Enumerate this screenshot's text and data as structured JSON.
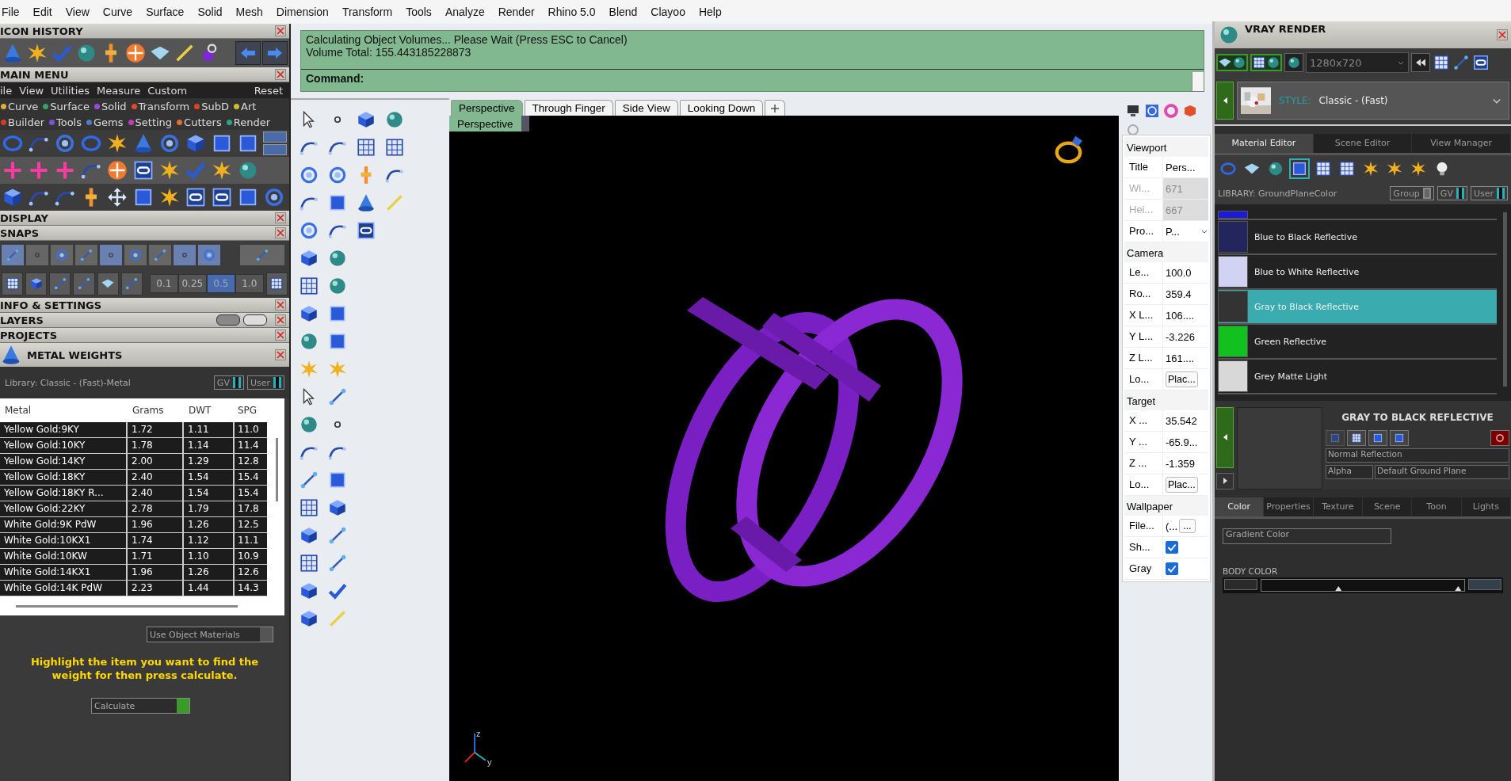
{
  "menu_bar": [
    "File",
    "Edit",
    "View",
    "Curve",
    "Surface",
    "Solid",
    "Mesh",
    "Dimension",
    "Transform",
    "Tools",
    "Analyze",
    "Render",
    "Rhino 5.0",
    "Blend",
    "Clayoo",
    "Help"
  ],
  "icon_history": {
    "title": "ICON HISTORY"
  },
  "main_menu": {
    "title": "MAIN MENU",
    "menu": [
      "ile",
      "View",
      "Utilities",
      "Measure",
      "Custom"
    ],
    "reset": "Reset",
    "category_rows": [
      {
        "items": [
          {
            "label": "Curve",
            "color": "#d8b03a"
          },
          {
            "label": "Surface",
            "color": "#3c9e6a"
          },
          {
            "label": "Solid",
            "color": "#9a4ad8"
          },
          {
            "label": "Transform",
            "color": "#e0482a"
          },
          {
            "label": "SubD",
            "color": "#e0402a"
          },
          {
            "label": "Art",
            "color": "#c8c032"
          }
        ]
      },
      {
        "items": [
          {
            "label": "Builder",
            "color": "#d83a2a"
          },
          {
            "label": "Tools",
            "color": "#7a52d8"
          },
          {
            "label": "Gems",
            "color": "#4a7ec0"
          },
          {
            "label": "Setting",
            "color": "#c83ab0"
          },
          {
            "label": "Cutters",
            "color": "#e0702a"
          },
          {
            "label": "Render",
            "color": "#2ea08e"
          }
        ]
      }
    ]
  },
  "display": {
    "title": "DISPLAY"
  },
  "snaps": {
    "title": "SNAPS",
    "toggles": [
      {
        "on": true
      },
      {
        "on": false
      },
      {
        "on": false
      },
      {
        "on": false
      },
      {
        "on": true
      },
      {
        "on": false
      },
      {
        "on": false
      },
      {
        "on": true
      },
      {
        "on": true
      },
      {
        "on": false
      }
    ],
    "steps": [
      {
        "label": "0.1",
        "selected": false
      },
      {
        "label": "0.25",
        "selected": false
      },
      {
        "label": "0.5",
        "selected": true
      },
      {
        "label": "1.0",
        "selected": false
      }
    ]
  },
  "info_settings": {
    "title": "INFO & SETTINGS"
  },
  "layers": {
    "title": "LAYERS"
  },
  "projects": {
    "title": "PROJECTS"
  },
  "metal_weights": {
    "title": "METAL WEIGHTS",
    "library": "Library: Classic - (Fast)-Metal",
    "toggles": [
      {
        "label": "GV",
        "on": true
      },
      {
        "label": "User",
        "on": true
      }
    ],
    "columns": [
      "Metal",
      "Grams",
      "DWT",
      "SPG"
    ],
    "rows": [
      [
        "Yellow Gold:9KY",
        "1.72",
        "1.11",
        "11.0"
      ],
      [
        "Yellow Gold:10KY",
        "1.78",
        "1.14",
        "11.4"
      ],
      [
        "Yellow Gold:14KY",
        "2.00",
        "1.29",
        "12.8"
      ],
      [
        "Yellow Gold:18KY",
        "2.40",
        "1.54",
        "15.4"
      ],
      [
        "Yellow Gold:18KY R...",
        "2.40",
        "1.54",
        "15.4"
      ],
      [
        "Yellow Gold:22KY",
        "2.78",
        "1.79",
        "17.8"
      ],
      [
        "White Gold:9K PdW",
        "1.96",
        "1.26",
        "12.5"
      ],
      [
        "White Gold:10KX1",
        "1.74",
        "1.12",
        "11.1"
      ],
      [
        "White Gold:10KW",
        "1.71",
        "1.10",
        "10.9"
      ],
      [
        "White Gold:14KX1",
        "1.96",
        "1.26",
        "12.6"
      ],
      [
        "White Gold:14K PdW",
        "2.23",
        "1.44",
        "14.3"
      ]
    ],
    "use_object_materials": {
      "label": "Use Object Materials",
      "on": false
    },
    "hint": "Highlight the item you want to find the weight for then press calculate.",
    "calculate": "Calculate"
  },
  "command": {
    "lines": [
      "Calculating Object Volumes... Please Wait (Press ESC to Cancel)",
      "Volume Total: 155.443185228873"
    ],
    "prompt": "Command:"
  },
  "viewport": {
    "tabs": [
      {
        "label": "Perspective",
        "selected": true
      },
      {
        "label": "Through Finger",
        "selected": false
      },
      {
        "label": "Side View",
        "selected": false
      },
      {
        "label": "Looking Down",
        "selected": false
      }
    ],
    "view_menu": "Perspective",
    "axis_labels": [
      "z",
      "y"
    ]
  },
  "properties": {
    "sections": [
      {
        "title": "Viewport",
        "rows": [
          {
            "kind": "text",
            "label": "Title",
            "value": "Pers...",
            "disabled": false
          },
          {
            "kind": "text",
            "label": "Wi...",
            "value": "671",
            "disabled": true
          },
          {
            "kind": "text",
            "label": "Hei...",
            "value": "667",
            "disabled": true
          },
          {
            "kind": "dropdown",
            "label": "Pro...",
            "value": "P...",
            "disabled": false
          }
        ]
      },
      {
        "title": "Camera",
        "rows": [
          {
            "kind": "text",
            "label": "Le...",
            "value": "100.0",
            "disabled": false
          },
          {
            "kind": "text",
            "label": "Ro...",
            "value": "359.4",
            "disabled": false
          },
          {
            "kind": "text",
            "label": "X L...",
            "value": "106....",
            "disabled": false
          },
          {
            "kind": "text",
            "label": "Y L...",
            "value": "-3.226",
            "disabled": false
          },
          {
            "kind": "text",
            "label": "Z L...",
            "value": "161....",
            "disabled": false
          },
          {
            "kind": "button",
            "label": "Lo...",
            "value": "Plac...",
            "disabled": false
          }
        ]
      },
      {
        "title": "Target",
        "rows": [
          {
            "kind": "text",
            "label": "X ...",
            "value": "35.542",
            "disabled": false
          },
          {
            "kind": "text",
            "label": "Y ...",
            "value": "-65.9...",
            "disabled": false
          },
          {
            "kind": "text",
            "label": "Z ...",
            "value": "-1.359",
            "disabled": false
          },
          {
            "kind": "button",
            "label": "Lo...",
            "value": "Plac...",
            "disabled": false
          }
        ]
      },
      {
        "title": "Wallpaper",
        "rows": [
          {
            "kind": "file",
            "label": "File...",
            "value": "(...",
            "button": "...",
            "disabled": false
          },
          {
            "kind": "checkbox",
            "label": "Sh...",
            "checked": true,
            "disabled": false
          },
          {
            "kind": "checkbox",
            "label": "Gray",
            "checked": true,
            "disabled": false
          }
        ]
      }
    ]
  },
  "vray": {
    "title": "VRAY RENDER",
    "resolution": "1280x720",
    "style_label": "STYLE:",
    "style": "Classic - (Fast)",
    "tabs": [
      {
        "label": "Material Editor",
        "selected": true
      },
      {
        "label": "Scene Editor",
        "selected": false
      },
      {
        "label": "View Manager",
        "selected": false
      }
    ],
    "library": "LIBRARY: GroundPlaneColor",
    "toggles": [
      {
        "label": "Group",
        "on": false
      },
      {
        "label": "GV",
        "on": true
      },
      {
        "label": "User",
        "on": true
      }
    ],
    "materials": [
      {
        "color": "#1a1ad8",
        "selected": false
      },
      {
        "name": "Blue to Black Reflective",
        "color": "#25255e",
        "selected": false
      },
      {
        "name": "Blue to White Reflective",
        "color": "#d2d2f2",
        "selected": false
      },
      {
        "name": "Gray to Black Reflective",
        "color": "#333333",
        "selected": true
      },
      {
        "name": "Green Reflective",
        "color": "#12c020",
        "selected": false
      },
      {
        "name": "Grey Matte Light",
        "color": "#d8d8d8",
        "selected": false
      }
    ],
    "material_title": "GRAY TO BLACK REFLECTIVE",
    "reflection": "Normal Reflection",
    "alpha": "Alpha",
    "ground": "Default Ground Plane",
    "detail_tabs": [
      {
        "label": "Color",
        "selected": true
      },
      {
        "label": "Properties",
        "selected": false
      },
      {
        "label": "Texture",
        "selected": false
      },
      {
        "label": "Scene",
        "selected": false
      },
      {
        "label": "Toon",
        "selected": false
      },
      {
        "label": "Lights",
        "selected": false
      }
    ],
    "color_mode": "Gradient Color",
    "body_color": {
      "label": "BODY COLOR",
      "stops": [
        {
          "level": 0.38
        },
        {
          "level": 0.97
        }
      ]
    }
  }
}
